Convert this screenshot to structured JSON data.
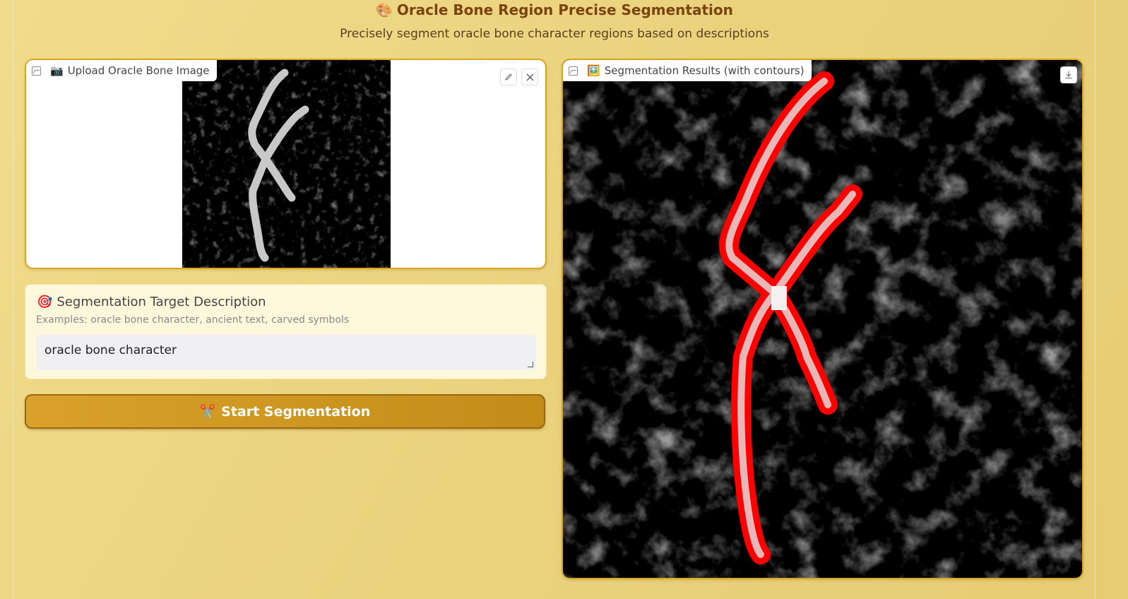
{
  "header": {
    "title_icon": "palette-icon",
    "title": "Oracle Bone Region Precise Segmentation",
    "subtitle": "Precisely segment oracle bone character regions based on descriptions"
  },
  "upload_panel": {
    "label": "Upload Oracle Bone Image",
    "label_icon": "camera-icon"
  },
  "description": {
    "title": "Segmentation Target Description",
    "title_icon": "target-icon",
    "hint": "Examples: oracle bone character, ancient text, carved symbols",
    "value": "oracle bone character"
  },
  "start_button": {
    "label": "Start Segmentation",
    "icon": "scissors-icon"
  },
  "result_panel": {
    "label": "Segmentation Results (with contours)",
    "label_icon": "picture-icon"
  },
  "colors": {
    "accent": "#d9a520",
    "title": "#7a4410",
    "contour": "#ff0000"
  }
}
